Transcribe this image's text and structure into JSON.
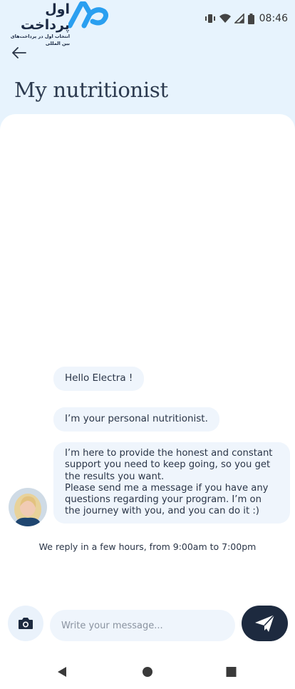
{
  "brand": {
    "name": "اول پرداخت",
    "tagline": "انتخاب اول در پرداخت‌های بین المللی",
    "logo_text": "AP",
    "logo_color": "#2a9ff0"
  },
  "status_bar": {
    "time": "08:46",
    "icons": [
      "vibrate-icon",
      "wifi-icon",
      "signal-icon",
      "battery-icon"
    ]
  },
  "header": {
    "back_icon": "arrow-left-icon",
    "title": "My nutritionist"
  },
  "chat": {
    "messages": [
      {
        "text": "Hello Electra !"
      },
      {
        "text": "I’m your personal nutritionist."
      },
      {
        "text": "I’m here to provide the honest and constant\nsupport you need to keep going, so you get\nthe results you want.\nPlease send me a message if you have any\nquestions regarding your program. I’m on\nthe journey with you, and you can do it :)"
      }
    ],
    "reply_info": "We reply in a few hours, from 9:00am to 7:00pm"
  },
  "composer": {
    "camera_icon": "camera-icon",
    "placeholder": "Write your message...",
    "value": "",
    "send_icon": "send-icon"
  },
  "nav": {
    "icons": [
      "back-triangle-icon",
      "home-circle-icon",
      "recents-square-icon"
    ]
  },
  "colors": {
    "header_bg": "#e7f3fd",
    "bubble_bg": "#eff5fc",
    "send_button": "#1d2a3f"
  }
}
